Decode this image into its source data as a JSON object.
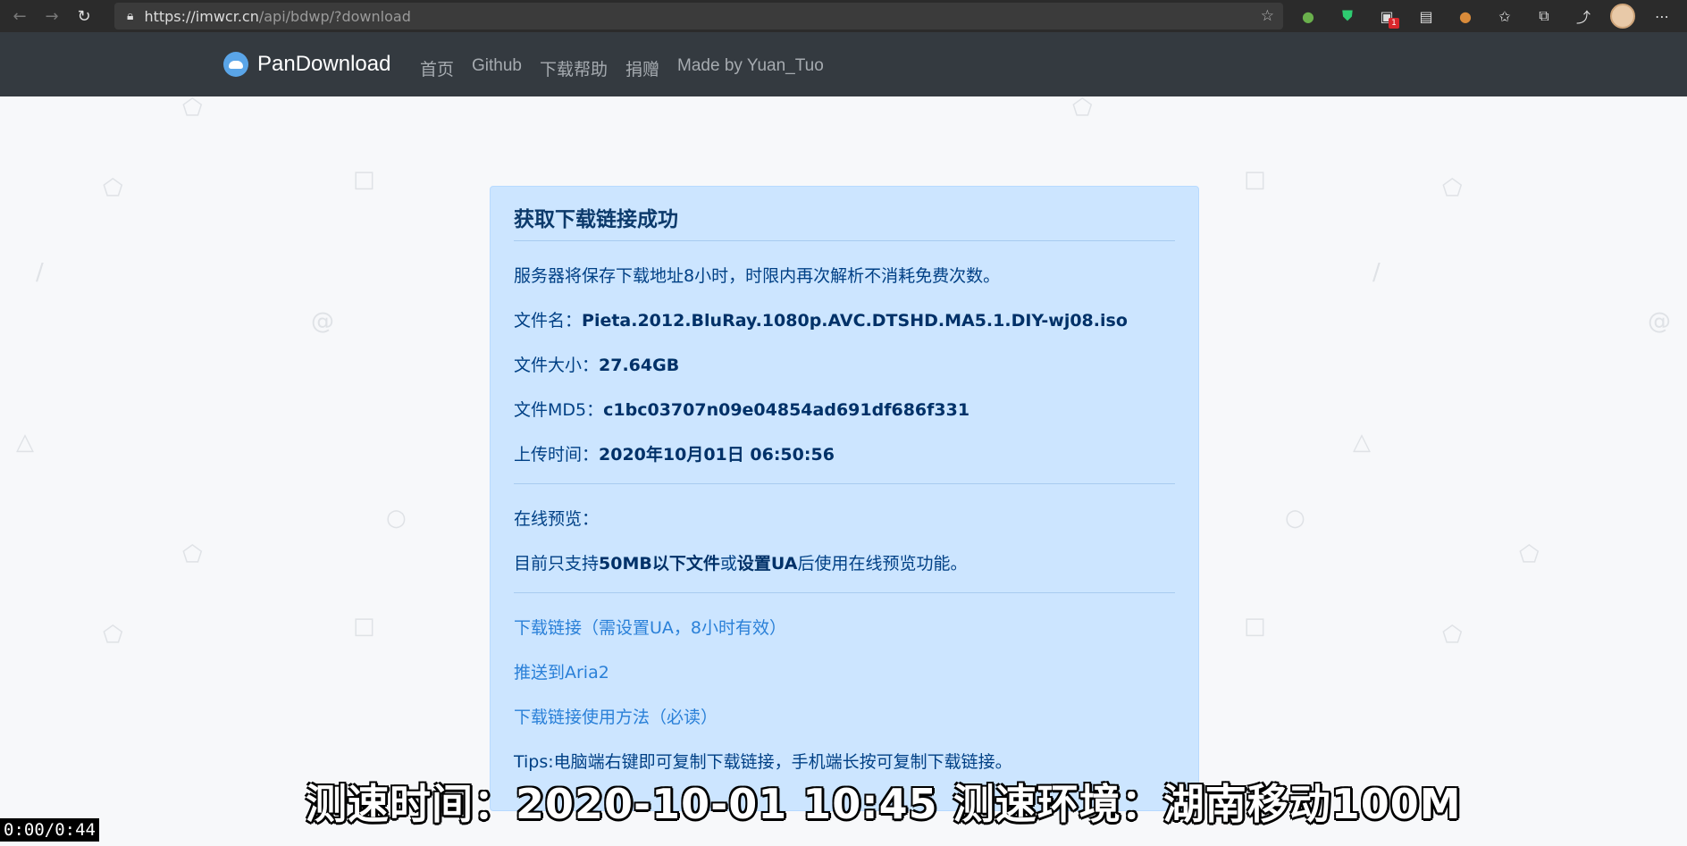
{
  "browser": {
    "url_host": "https://imwcr.cn",
    "url_path": "/api/bdwp/?download"
  },
  "site": {
    "brand": "PanDownload",
    "menu": [
      "首页",
      "Github",
      "下载帮助",
      "捐赠",
      "Made by Yuan_Tuo"
    ]
  },
  "card": {
    "title": "获取下载链接成功",
    "notice": "服务器将保存下载地址8小时，时限内再次解析不消耗免费次数。",
    "filename_label": "文件名：",
    "filename": "Pieta.2012.BluRay.1080p.AVC.DTSHD.MA5.1.DIY-wj08.iso",
    "size_label": "文件大小：",
    "size": "27.64GB",
    "md5_label": "文件MD5：",
    "md5": "c1bc03707n09e04854ad691df686f331",
    "upload_label": "上传时间：",
    "upload_time": "2020年10月01日 06:50:56",
    "preview_label": "在线预览：",
    "preview_note_1": "目前只支持",
    "preview_note_bold1": "50MB以下文件",
    "preview_note_2": "或",
    "preview_note_bold2": "设置UA",
    "preview_note_3": "后使用在线预览功能。",
    "link_download": "下载链接（需设置UA，8小时有效）",
    "link_aria2": "推送到Aria2",
    "link_howto": "下载链接使用方法（必读）",
    "tips": "Tips:电脑端右键即可复制下载链接，手机端长按可复制下载链接。"
  },
  "overlay": {
    "subtitle": "测速时间：2020-10-01 10:45   测速环境：湖南移动100M",
    "timer": "0:00/0:44"
  },
  "ext_badge": "1"
}
